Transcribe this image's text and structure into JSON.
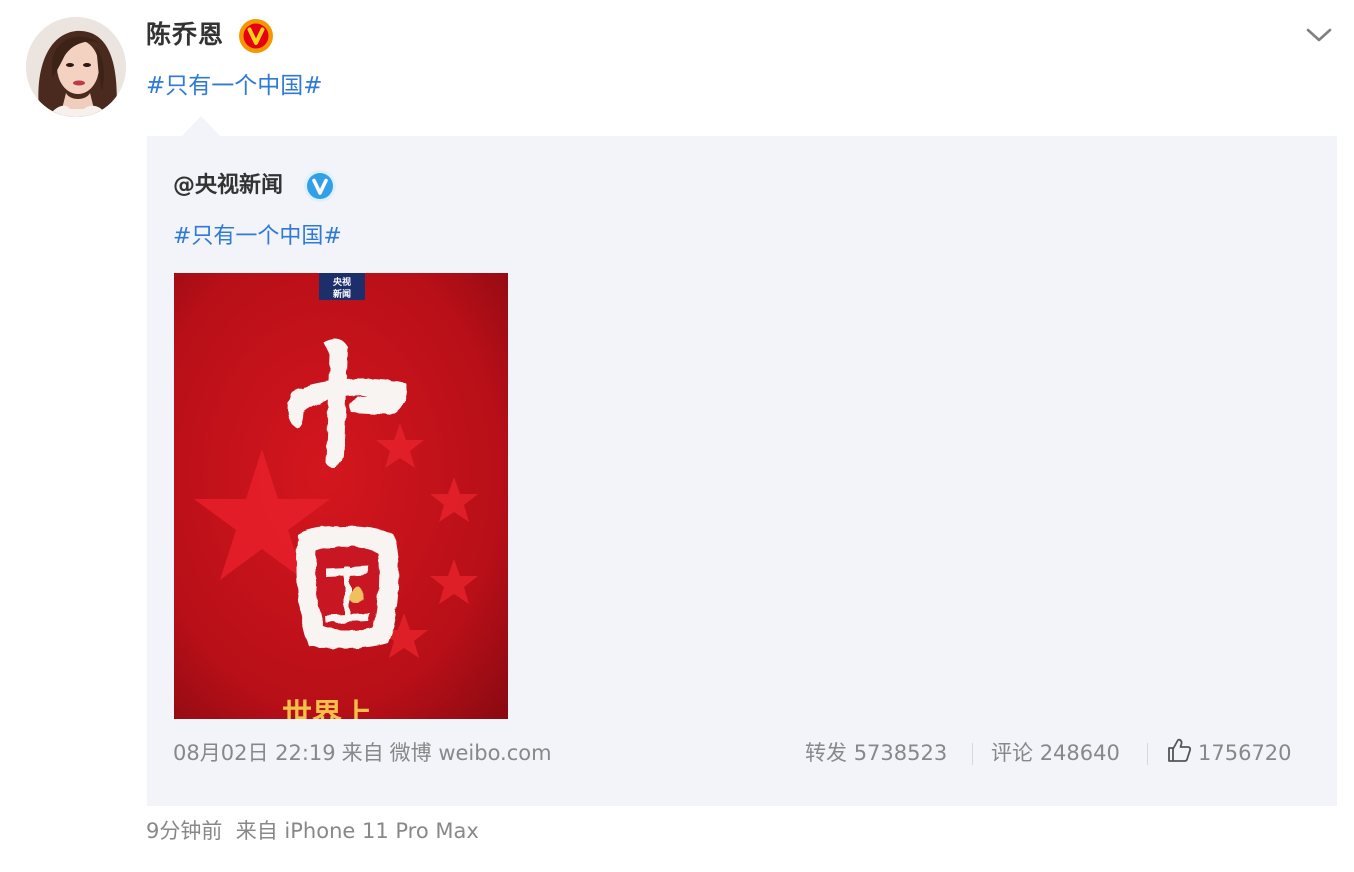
{
  "post": {
    "author": "陈乔恩",
    "author_badge": "orange-v-verified-badge",
    "text": "#只有一个中国#",
    "source": {
      "time": "9分钟前",
      "from_label": "来自",
      "device": "iPhone 11 Pro Max"
    }
  },
  "repost": {
    "author": "@央视新闻",
    "author_badge": "blue-v-verified-badge",
    "text": "#只有一个中国#",
    "image": {
      "logo_text": "央视新闻",
      "calligraphy_text": "中国",
      "bottom_text": "世界上"
    },
    "meta": {
      "date": "08月02日 22:19",
      "from_label": "来自",
      "platform": "微博 weibo.com"
    },
    "actions": {
      "repost_label": "转发",
      "repost_count": "5738523",
      "comment_label": "评论",
      "comment_count": "248640",
      "like_count": "1756720"
    }
  },
  "colors": {
    "link_blue": "#2f7ad6",
    "repost_bg": "#f2f4f9",
    "meta_gray": "#888888",
    "badge_orange": "#f39800",
    "badge_blue": "#32a0e6",
    "poster_red": "#c8141e"
  }
}
